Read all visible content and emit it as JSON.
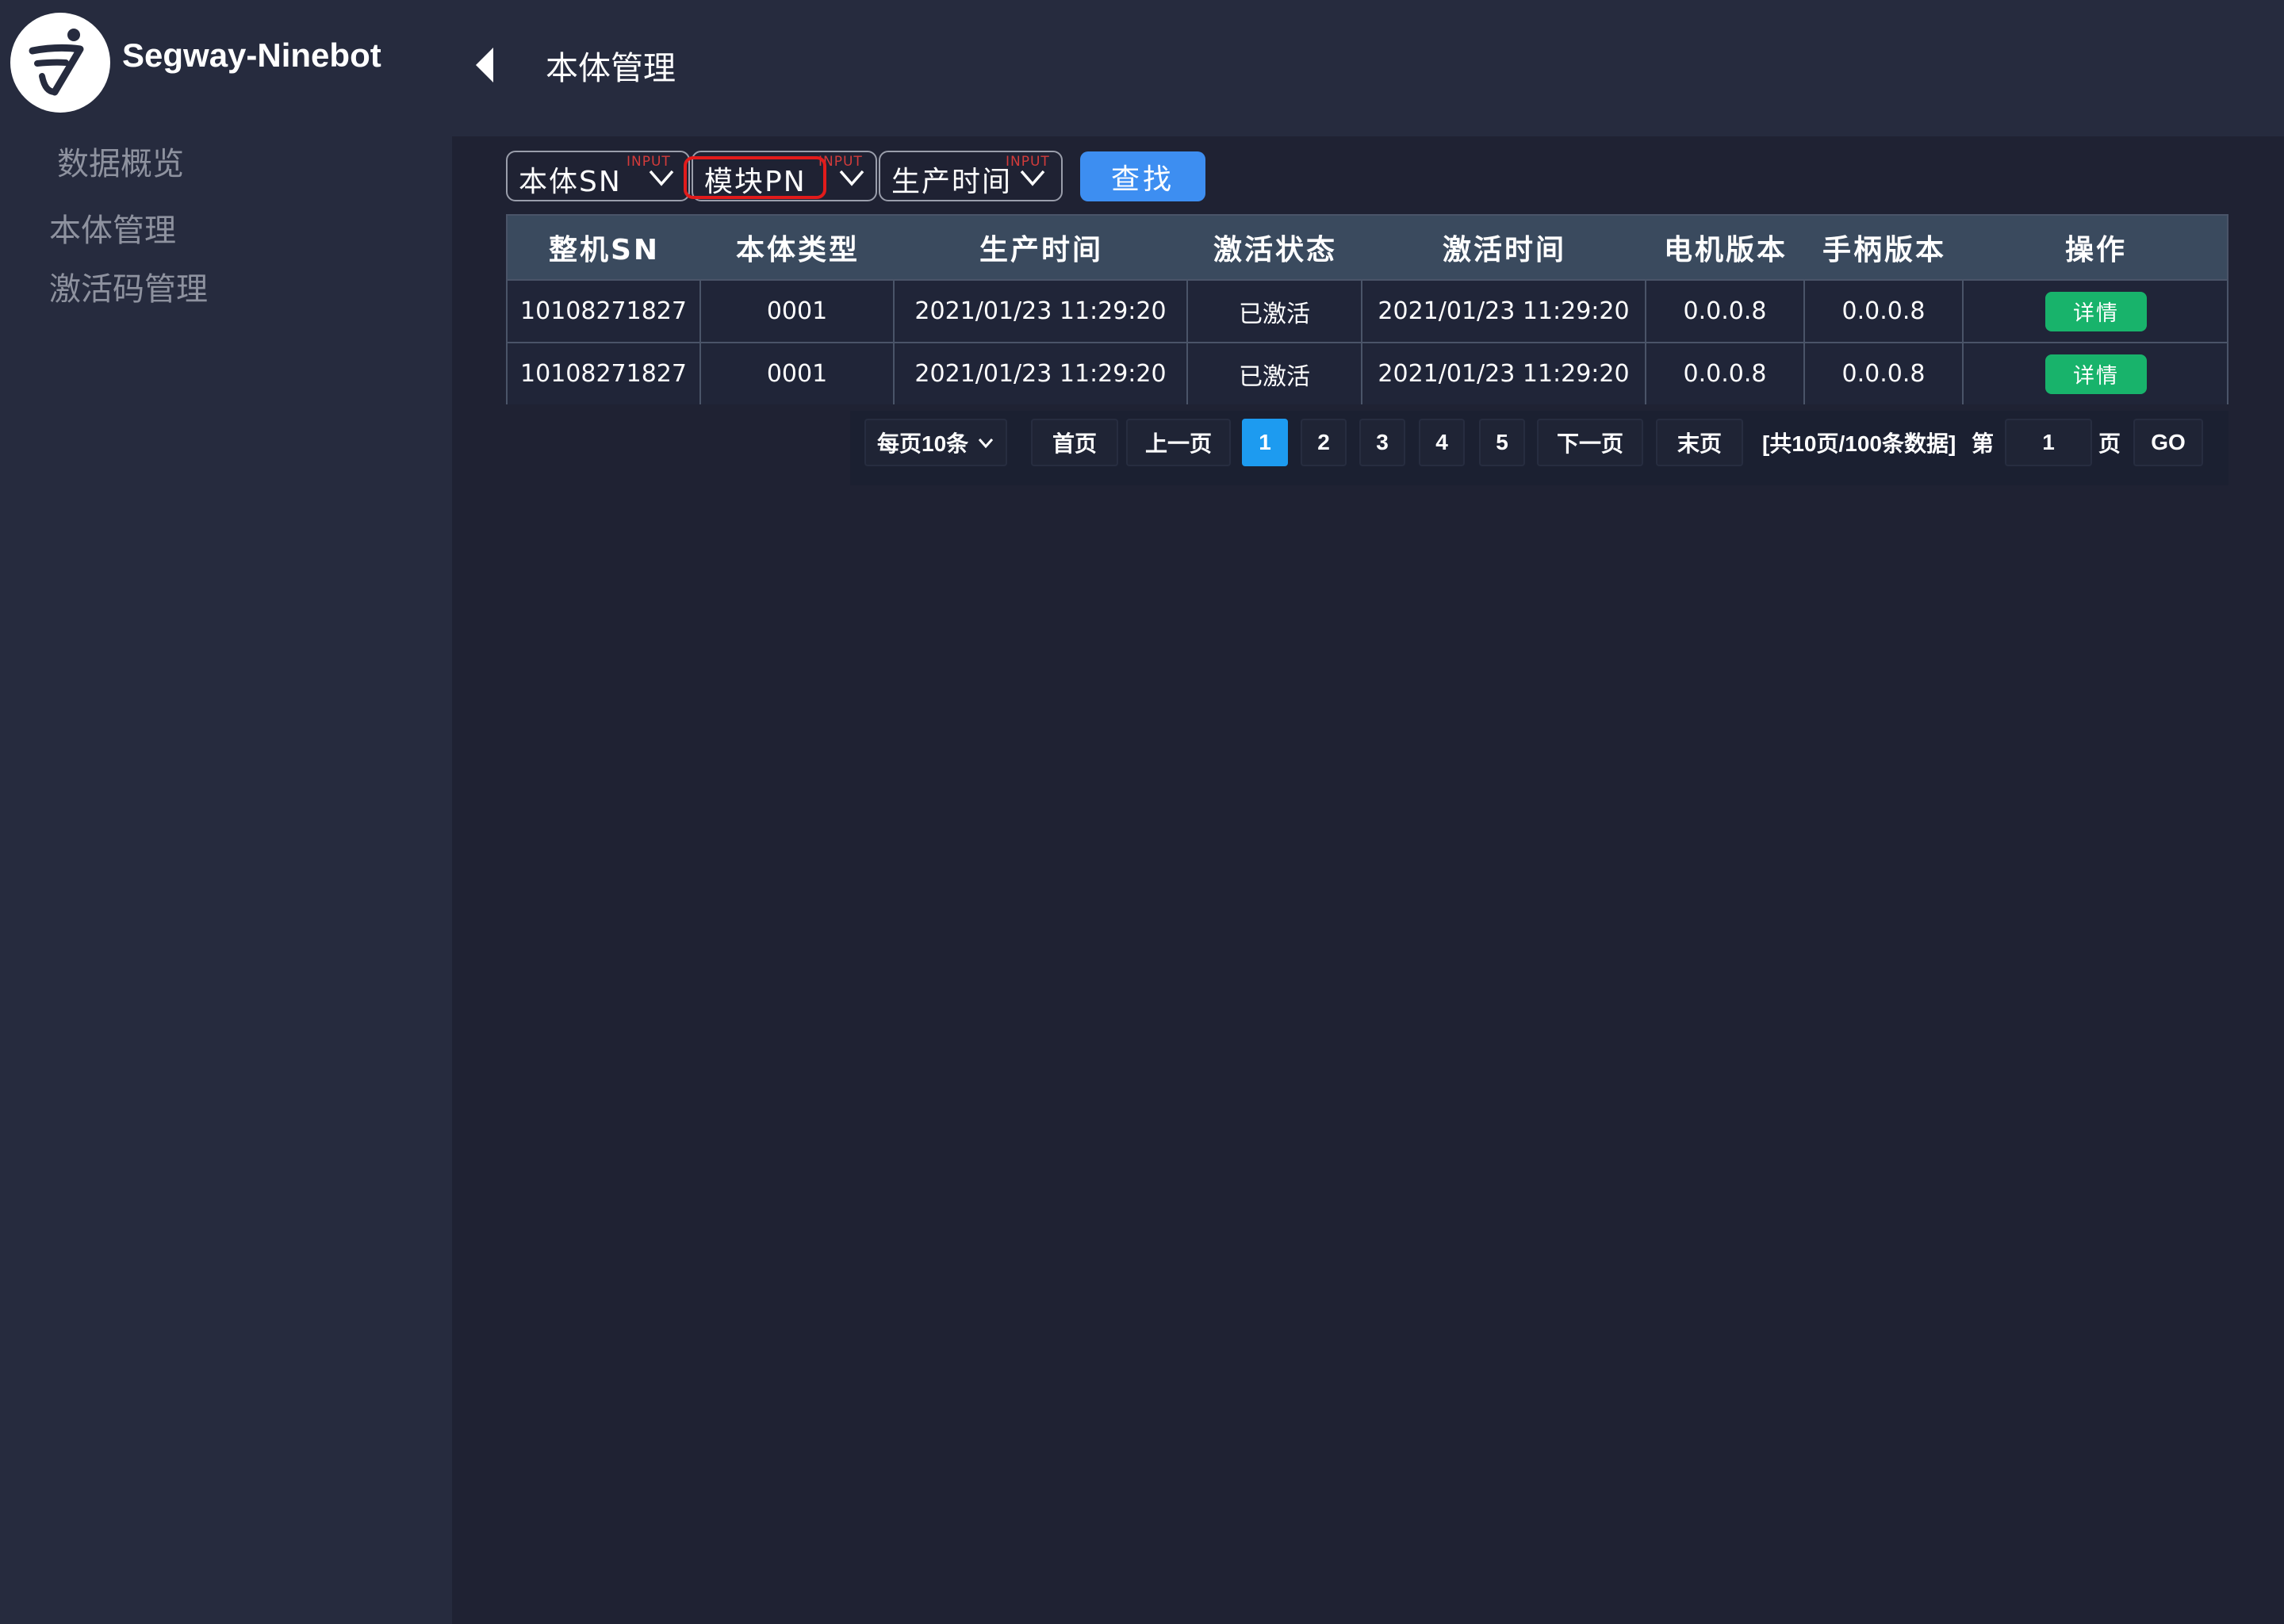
{
  "header": {
    "brand": "Segway-Ninebot",
    "page_title": "本体管理"
  },
  "sidebar": {
    "items": [
      {
        "label": "数据概览"
      },
      {
        "label": "本体管理"
      },
      {
        "label": "激活码管理"
      }
    ]
  },
  "filters": [
    {
      "label": "本体SN",
      "tag": "INPUT"
    },
    {
      "label": "模块PN",
      "tag": "INPUT"
    },
    {
      "label": "生产时间",
      "tag": "INPUT"
    }
  ],
  "search_label": "查找",
  "table": {
    "columns": [
      "整机SN",
      "本体类型",
      "生产时间",
      "激活状态",
      "激活时间",
      "电机版本",
      "手柄版本",
      "操作"
    ],
    "rows": [
      [
        "10108271827",
        "0001",
        "2021/01/23 11:29:20",
        "已激活",
        "2021/01/23 11:29:20",
        "0.0.0.8",
        "0.0.0.8",
        "详情"
      ],
      [
        "10108271827",
        "0001",
        "2021/01/23 11:29:20",
        "已激活",
        "2021/01/23 11:29:20",
        "0.0.0.8",
        "0.0.0.8",
        "详情"
      ]
    ]
  },
  "pagination": {
    "page_size": "每页10条",
    "first": "首页",
    "prev": "上一页",
    "pages": [
      "1",
      "2",
      "3",
      "4",
      "5"
    ],
    "current_page": "1",
    "next": "下一页",
    "last": "末页",
    "summary": "[共10页/100条数据]",
    "goto_prefix": "第",
    "goto_value": "1",
    "goto_suffix": "页",
    "go": "GO"
  },
  "colors": {
    "background": "#1f2233",
    "panel": "#262b3e",
    "table_header": "#3a4a5e",
    "primary": "#3d8ef1",
    "success": "#18b36b",
    "active_page": "#1d9bf0",
    "highlight": "#e21b1b"
  },
  "icons": {
    "logo": "scooter-logo-icon",
    "collapse": "caret-left-icon",
    "dropdown": "chevron-down-icon"
  }
}
